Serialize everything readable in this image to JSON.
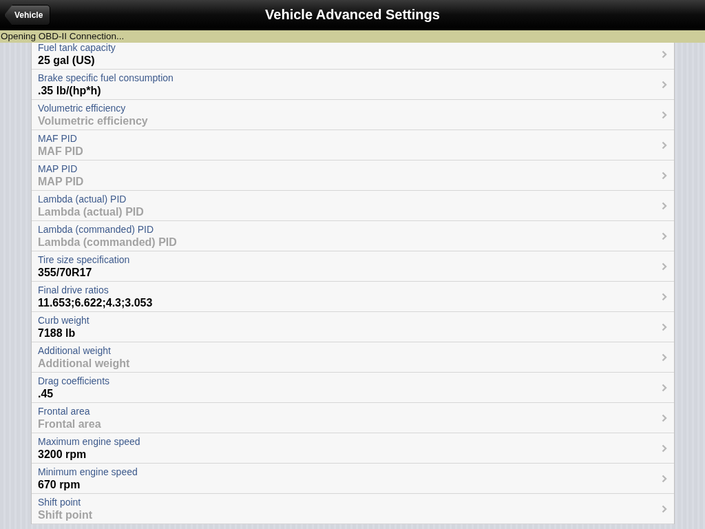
{
  "nav_bar": {
    "back_button": "Vehicle",
    "title": "Vehicle Advanced Settings"
  },
  "status_bar": {
    "text": "Opening OBD-II Connection..."
  },
  "settings": [
    {
      "label": "Fuel tank capacity",
      "value": "25 gal (US)"
    },
    {
      "label": "Brake specific fuel consumption",
      "value": ".35 lb/(hp*h)"
    },
    {
      "label": "Volumetric efficiency",
      "placeholder": "Volumetric efficiency"
    },
    {
      "label": "MAF PID",
      "placeholder": "MAF PID"
    },
    {
      "label": "MAP PID",
      "placeholder": "MAP PID"
    },
    {
      "label": "Lambda (actual) PID",
      "placeholder": "Lambda (actual) PID"
    },
    {
      "label": "Lambda (commanded) PID",
      "placeholder": "Lambda (commanded) PID"
    },
    {
      "label": "Tire size specification",
      "value": "355/70R17"
    },
    {
      "label": "Final drive ratios",
      "value": "11.653;6.622;4.3;3.053"
    },
    {
      "label": "Curb weight",
      "value": "7188 lb"
    },
    {
      "label": "Additional weight",
      "placeholder": "Additional weight"
    },
    {
      "label": "Drag coefficients",
      "value": ".45"
    },
    {
      "label": "Frontal area",
      "placeholder": "Frontal area"
    },
    {
      "label": "Maximum engine speed",
      "value": "3200 rpm"
    },
    {
      "label": "Minimum engine speed",
      "value": "670 rpm"
    },
    {
      "label": "Shift point",
      "placeholder": "Shift point"
    }
  ]
}
